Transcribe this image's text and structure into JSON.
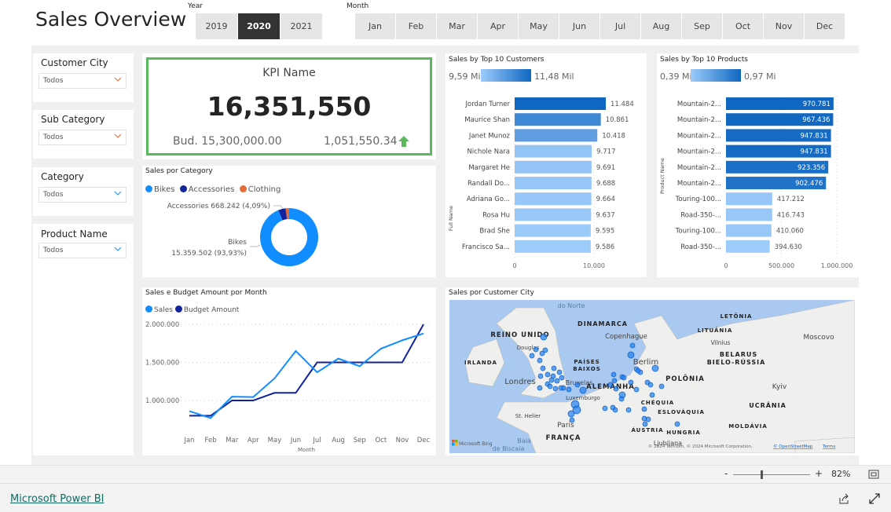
{
  "header": {
    "title": "Sales Overview",
    "year_label": "Year",
    "years": [
      "2019",
      "2020",
      "2021"
    ],
    "selected_year": "2020",
    "month_label": "Month",
    "months": [
      "Jan",
      "Feb",
      "Mar",
      "Apr",
      "May",
      "Jun",
      "Jul",
      "Aug",
      "Sep",
      "Oct",
      "Nov",
      "Dec"
    ]
  },
  "slicers": [
    {
      "title": "Customer City",
      "value": "Todos"
    },
    {
      "title": "Sub Category",
      "value": "Todos"
    },
    {
      "title": "Category",
      "value": "Todos"
    },
    {
      "title": "Product Name",
      "value": "Todos"
    }
  ],
  "kpi": {
    "name": "KPI Name",
    "value": "16,351,550",
    "budget": "Bud. 15,300,000.00",
    "variance": "1,051,550.34",
    "trend_icon": "arrow-up-icon",
    "border_color": "#5cb85c"
  },
  "colors": {
    "accent": "#118dff",
    "dark": "#12239e",
    "orange": "#e66c37",
    "bar_dark": "#0f67c1",
    "bar_light": "#9dcbfa"
  },
  "chart_data": [
    {
      "type": "pie",
      "title": "Sales por Category",
      "legend": [
        "Bikes",
        "Accessories",
        "Clothing"
      ],
      "values": [
        15359502,
        668242,
        323806
      ],
      "percent": [
        93.93,
        4.09,
        1.98
      ],
      "data_labels": [
        "Accessories 668.242 (4,09%)",
        "Bikes",
        "15.359.502 (93,93%)"
      ],
      "colors": [
        "#118dff",
        "#12239e",
        "#e66c37"
      ],
      "legend_position": "top-left"
    },
    {
      "type": "bar",
      "title": "Sales by Top 10 Customers",
      "ylabel": "Full Name",
      "gradient_min": "9,59 Mil",
      "gradient_max": "11,48 Mil",
      "categories": [
        "Jordan Turner",
        "Maurice Shan",
        "Janet Munoz",
        "Nichole Nara",
        "Margaret He",
        "Randall Do...",
        "Adriana Go...",
        "Rosa Hu",
        "Brad She",
        "Francisco Sa..."
      ],
      "values": [
        11484,
        10861,
        10418,
        9717,
        9691,
        9688,
        9664,
        9637,
        9595,
        9586
      ],
      "labels": [
        "11.484",
        "10.861",
        "10.418",
        "9.717",
        "9.691",
        "9.688",
        "9.664",
        "9.637",
        "9.595",
        "9.586"
      ],
      "xticks": [
        "0",
        "10.000"
      ],
      "xlim": [
        0,
        12500
      ]
    },
    {
      "type": "bar",
      "title": "Sales by Top 10 Products",
      "ylabel": "Product Name",
      "gradient_min": "0,39 Mi",
      "gradient_max": "0,97 Mi",
      "categories": [
        "Mountain-2...",
        "Mountain-2...",
        "Mountain-2...",
        "Mountain-2...",
        "Mountain-2...",
        "Mountain-2...",
        "Touring-100...",
        "Road-350-...",
        "Touring-100...",
        "Road-350-..."
      ],
      "values": [
        970781,
        967436,
        947831,
        947831,
        923356,
        902476,
        417212,
        416743,
        410060,
        394630
      ],
      "labels": [
        "970.781",
        "967.436",
        "947.831",
        "947.831",
        "923.356",
        "902.476",
        "417.212",
        "416.743",
        "410.060",
        "394.630"
      ],
      "xticks": [
        "0",
        "500.000",
        "1.000.000"
      ],
      "xlim": [
        0,
        1000000
      ]
    },
    {
      "type": "line",
      "title": "Sales e Budget Amount por Month",
      "xlabel": "Month",
      "categories": [
        "Jan",
        "Feb",
        "Mar",
        "Apr",
        "May",
        "Jun",
        "Jul",
        "Aug",
        "Sep",
        "Oct",
        "Nov",
        "Dec"
      ],
      "series": [
        {
          "name": "Sales",
          "color": "#118dff",
          "values": [
            860000,
            770000,
            1050000,
            1045000,
            1290000,
            1650000,
            1370000,
            1550000,
            1450000,
            1680000,
            1790000,
            1880000
          ]
        },
        {
          "name": "Budget Amount",
          "color": "#12239e",
          "values": [
            800000,
            800000,
            1000000,
            1000000,
            1100000,
            1100000,
            1500000,
            1500000,
            1500000,
            1500000,
            1500000,
            2000000
          ]
        }
      ],
      "yticks": [
        "1.000.000",
        "1.500.000",
        "2.000.000"
      ],
      "ylim": [
        600000,
        2100000
      ],
      "grid": true,
      "legend_position": "top-left"
    }
  ],
  "map": {
    "title": "Sales por Customer City",
    "labels": [
      "do Norte",
      "DINAMARCA",
      "REINO UNIDO",
      "Copenhague",
      "Douglas",
      "IRLANDA",
      "PAÍSES",
      "BAIXOS",
      "Berlim",
      "Londres",
      "Bruxelas",
      "ALEMANHA",
      "POLÔNIA",
      "Luxemburgo",
      "CHÉQUIA",
      "St. Helier",
      "Paris",
      "ESLOVÁQUIA",
      "ÁUSTRIA",
      "HUNGRIA",
      "FRANÇA",
      "Baia",
      "de Biscaia",
      "Ljubljana",
      "LETÔNIA",
      "LITUÂNIA",
      "Vilnius",
      "BELARUS",
      "BIELO-RÚSSIA",
      "Moscovo",
      "Kyiv",
      "UCRÂNIA",
      "MOLDÁVIA"
    ],
    "brand": "Microsoft Bing",
    "attribution": "© 2024 TomTom, © 2024 Microsoft Corporation, ",
    "osm": "© OpenStreetMap",
    "terms": "Terms"
  },
  "status": {
    "zoom": "82%",
    "minus": "-",
    "plus": "+"
  },
  "footer": {
    "link": "Microsoft Power BI"
  }
}
